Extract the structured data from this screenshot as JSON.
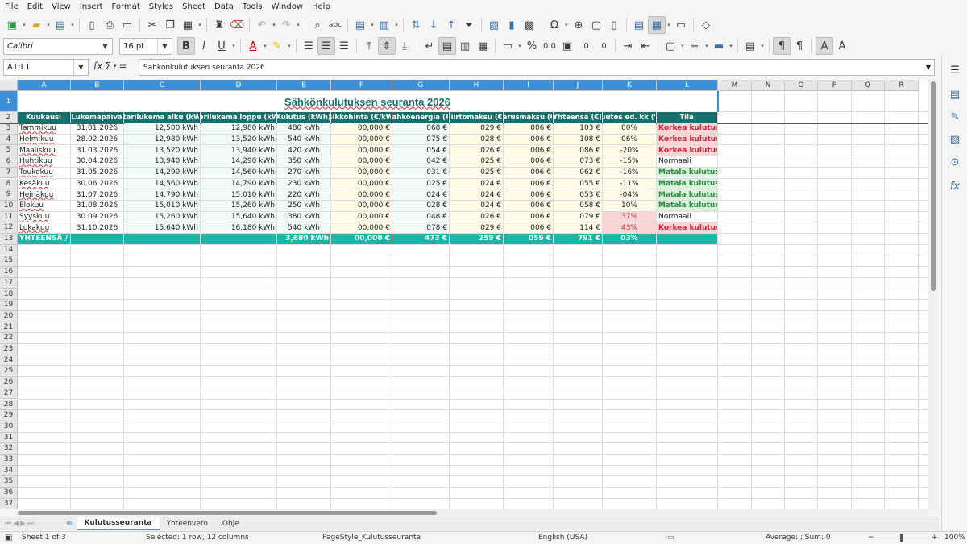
{
  "menu": [
    "File",
    "Edit",
    "View",
    "Insert",
    "Format",
    "Styles",
    "Sheet",
    "Data",
    "Tools",
    "Window",
    "Help"
  ],
  "toolbar": {
    "font_name": "Calibri",
    "font_size": "16 pt"
  },
  "formula_bar": {
    "name_box": "A1:L1",
    "formula": "Sähkönkulutuksen seuranta 2026"
  },
  "columns": [
    "A",
    "B",
    "C",
    "D",
    "E",
    "F",
    "G",
    "H",
    "I",
    "J",
    "K",
    "L",
    "M",
    "N",
    "O",
    "P",
    "Q",
    "R"
  ],
  "rows": [
    "1",
    "2",
    "3",
    "4",
    "5",
    "6",
    "7",
    "8",
    "9",
    "10",
    "11",
    "12",
    "13",
    "14",
    "15",
    "16",
    "17",
    "18",
    "19",
    "20",
    "21",
    "22",
    "23",
    "24",
    "25",
    "26",
    "27",
    "28",
    "29",
    "30",
    "31",
    "32",
    "33",
    "34",
    "35",
    "36",
    "37"
  ],
  "title": "Sähkönkulutuksen seuranta 2026",
  "headers": [
    "Kuukausi",
    "Lukemapäivä",
    "ittarilukema alku (kWh",
    "ttarilukema loppu (kWh",
    "Kulutus (kWh)",
    "ksikköhinta (€/kWh",
    "Sähköenergia (€)",
    "Siirtomaksu (€)",
    "Perusmaksu (€)",
    "Yhteensä (€)",
    "Muutos ed. kk (%)",
    "Tila"
  ],
  "data_rows": [
    [
      "Tammikuu",
      "31.01.2026",
      "12,500 kWh",
      "12,980 kWh",
      "480 kWh",
      "00,000 €",
      "068 €",
      "029 €",
      "006 €",
      "103 €",
      "00%",
      "Korkea kulutus"
    ],
    [
      "Helmikuu",
      "28.02.2026",
      "12,980 kWh",
      "13,520 kWh",
      "540 kWh",
      "00,000 €",
      "075 €",
      "028 €",
      "006 €",
      "108 €",
      "06%",
      "Korkea kulutus"
    ],
    [
      "Maaliskuu",
      "31.03.2026",
      "13,520 kWh",
      "13,940 kWh",
      "420 kWh",
      "00,000 €",
      "054 €",
      "026 €",
      "006 €",
      "086 €",
      "-20%",
      "Korkea kulutus"
    ],
    [
      "Huhtikuu",
      "30.04.2026",
      "13,940 kWh",
      "14,290 kWh",
      "350 kWh",
      "00,000 €",
      "042 €",
      "025 €",
      "006 €",
      "073 €",
      "-15%",
      "Normaali"
    ],
    [
      "Toukokuu",
      "31.05.2026",
      "14,290 kWh",
      "14,560 kWh",
      "270 kWh",
      "00,000 €",
      "031 €",
      "025 €",
      "006 €",
      "062 €",
      "-16%",
      "Matala kulutus"
    ],
    [
      "Kesäkuu",
      "30.06.2026",
      "14,560 kWh",
      "14,790 kWh",
      "230 kWh",
      "00,000 €",
      "025 €",
      "024 €",
      "006 €",
      "055 €",
      "-11%",
      "Matala kulutus"
    ],
    [
      "Heinäkuu",
      "31.07.2026",
      "14,790 kWh",
      "15,010 kWh",
      "220 kWh",
      "00,000 €",
      "024 €",
      "024 €",
      "006 €",
      "053 €",
      "-04%",
      "Matala kulutus"
    ],
    [
      "Elokuu",
      "31.08.2026",
      "15,010 kWh",
      "15,260 kWh",
      "250 kWh",
      "00,000 €",
      "028 €",
      "024 €",
      "006 €",
      "058 €",
      "10%",
      "Matala kulutus"
    ],
    [
      "Syyskuu",
      "30.09.2026",
      "15,260 kWh",
      "15,640 kWh",
      "380 kWh",
      "00,000 €",
      "048 €",
      "026 €",
      "006 €",
      "079 €",
      "37%",
      "Normaali"
    ],
    [
      "Lokakuu",
      "31.10.2026",
      "15,640 kWh",
      "16,180 kWh",
      "540 kWh",
      "00,000 €",
      "078 €",
      "029 €",
      "006 €",
      "114 €",
      "43%",
      "Korkea kulutus"
    ]
  ],
  "totals": [
    "YHTEENSÄ / KESKIARVO",
    "",
    "",
    "",
    "3,680 kWh",
    "00,000 €",
    "473 €",
    "259 €",
    "059 €",
    "791 €",
    "03%",
    ""
  ],
  "sheet_tabs": [
    "Kulutusseuranta",
    "Yhteenveto",
    "Ohje"
  ],
  "status": {
    "sheet": "Sheet 1 of 3",
    "selection": "Selected: 1 row, 12 columns",
    "page_style": "PageStyle_Kulutusseuranta",
    "language": "English (USA)",
    "summary": "Average: ; Sum: 0",
    "zoom": "100%"
  },
  "colors": {
    "header_bg": "#18706d",
    "total_bg": "#1bb5a6",
    "high_bg": "#fbd4d6",
    "high_text": "#c5243a",
    "low_bg": "#d9f3de",
    "low_text": "#2d8c3c",
    "selection": "#3d8fd7"
  }
}
